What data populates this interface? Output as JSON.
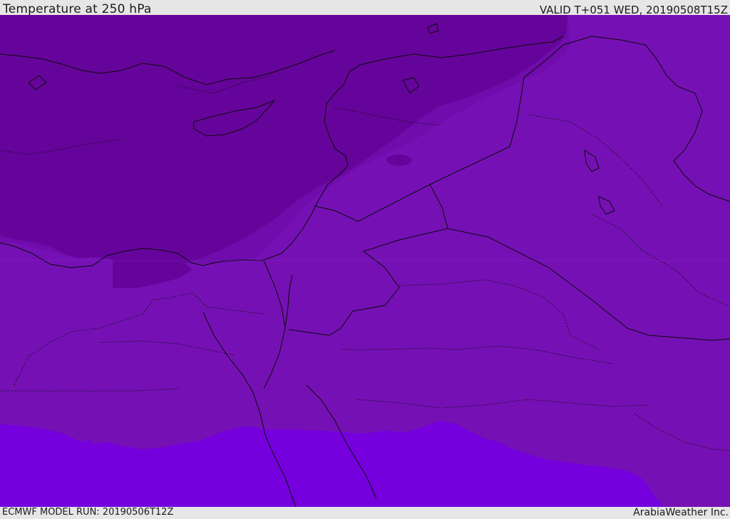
{
  "header": {
    "title": "Temperature at 250 hPa",
    "valid": "VALID T+051 WED, 20190508T15Z"
  },
  "footer": {
    "model_run": "ECMWF MODEL RUN: 20190506T12Z",
    "credit": "ArabiaWeather Inc."
  },
  "map": {
    "region": "Eastern Mediterranean, Levant, Egypt and northern Arabia",
    "colors": {
      "coldest_band": "#65049a",
      "cold_band": "#7411b5",
      "mid_band": "#7511b4",
      "warm_band": "#7500dd",
      "outline": "#0a0a0a",
      "frame_bg": "#e6e6e6"
    }
  }
}
